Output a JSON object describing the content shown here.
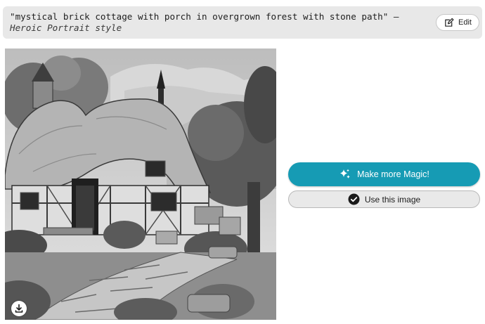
{
  "prompt": {
    "text": "\"mystical brick cottage with porch in overgrown forest with stone path\"",
    "separator": " — ",
    "style": "Heroic Portrait style"
  },
  "edit_button": {
    "label": "Edit",
    "icon": "edit-square-icon"
  },
  "image": {
    "alt": ""
  },
  "download_button": {
    "icon": "download-icon"
  },
  "actions": {
    "magic_label": "Make more Magic!",
    "magic_icon": "sparkles-icon",
    "use_label": "Use this image",
    "use_icon": "check-circle-icon"
  },
  "colors": {
    "accent": "#169bb4",
    "prompt_bg": "#e8e8e8",
    "secondary_button_bg": "#e9e9e9"
  }
}
